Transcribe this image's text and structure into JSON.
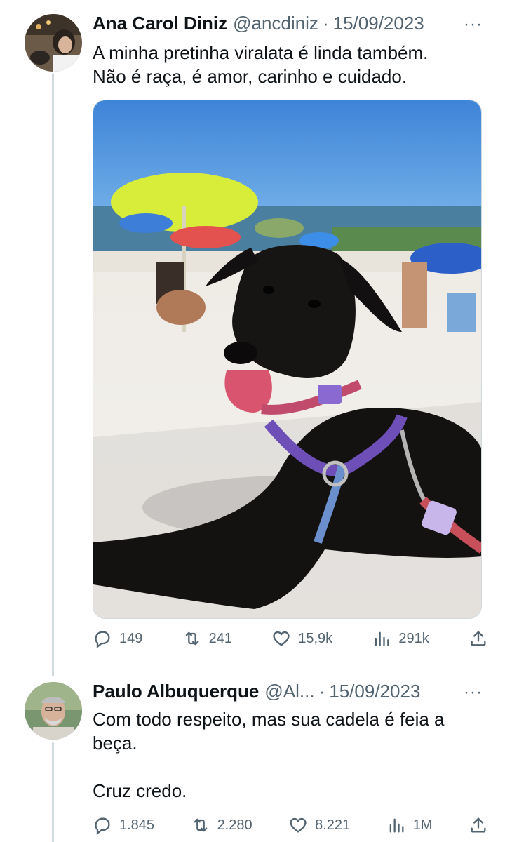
{
  "tweets": [
    {
      "author": {
        "display_name": "Ana Carol Diniz",
        "handle": "@ancdiniz"
      },
      "separator": "·",
      "date": "15/09/2023",
      "more": "···",
      "text": "A minha pretinha viralata é linda também.\nNão é raça, é amor, carinho e cuidado.",
      "media": {
        "icon": "photo-dog-on-beach"
      },
      "metrics": {
        "replies": "149",
        "retweets": "241",
        "likes": "15,9k",
        "views": "291k"
      }
    },
    {
      "author": {
        "display_name": "Paulo Albuquerque",
        "handle": "@Al..."
      },
      "separator": "·",
      "date": "15/09/2023",
      "more": "···",
      "text": "Com todo respeito, mas sua cadela é feia a beça.\n\nCruz credo.",
      "metrics": {
        "replies": "1.845",
        "retweets": "2.280",
        "likes": "8.221",
        "views": "1M"
      }
    }
  ],
  "colors": {
    "text": "#0f1419",
    "secondary": "#536471",
    "thread_line": "#cfd9de",
    "background": "#ffffff"
  },
  "icons": [
    "reply-icon",
    "retweet-icon",
    "like-icon",
    "views-icon",
    "share-icon",
    "more-icon"
  ]
}
